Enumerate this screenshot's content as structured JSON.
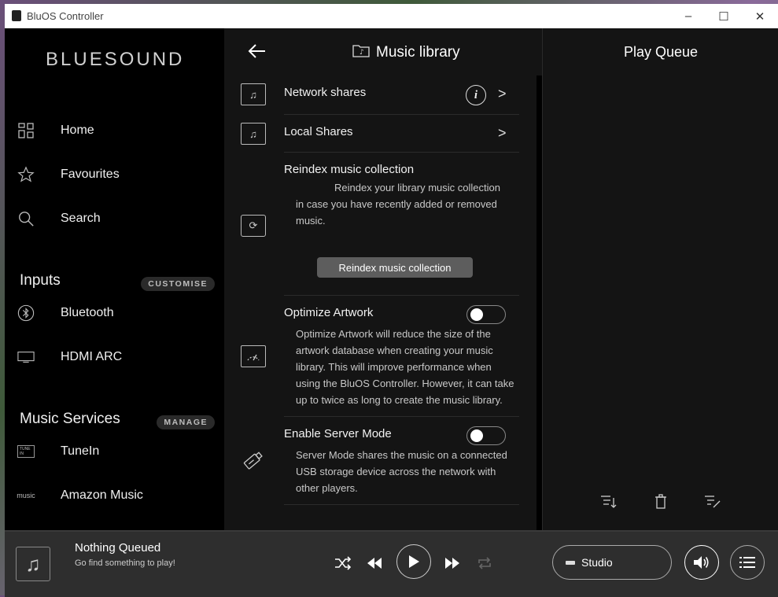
{
  "window": {
    "title": "BluOS Controller",
    "minimize": "–",
    "maximize": "☐",
    "close": "✕"
  },
  "sidebar": {
    "logo": "BLUESOUND",
    "nav": [
      {
        "label": "Home",
        "icon": "grid-icon"
      },
      {
        "label": "Favourites",
        "icon": "star-icon"
      },
      {
        "label": "Search",
        "icon": "search-icon"
      }
    ],
    "inputs_heading": "Inputs",
    "inputs_action": "CUSTOMISE",
    "inputs": [
      {
        "label": "Bluetooth",
        "icon": "bluetooth-icon"
      },
      {
        "label": "HDMI ARC",
        "icon": "tv-icon"
      }
    ],
    "services_heading": "Music Services",
    "services_action": "MANAGE",
    "services": [
      {
        "label": "TuneIn",
        "icon": "tunein-logo-icon"
      },
      {
        "label": "Amazon Music",
        "icon": "amazon-music-logo-icon"
      }
    ]
  },
  "library": {
    "title": "Music library",
    "network_shares": "Network shares",
    "local_shares": "Local Shares",
    "reindex": {
      "title": "Reindex music collection",
      "desc_line1": "Reindex your library music collection",
      "desc_line2": "in case you have recently added or removed",
      "desc_line3": "music.",
      "button": "Reindex music collection"
    },
    "optimize": {
      "title": "Optimize Artwork",
      "enabled": false,
      "desc": [
        "Optimize Artwork will reduce the size of the",
        "artwork database when creating your music",
        "library. This will improve performance when",
        "using the BluOS Controller. However, it can take",
        "up to twice as long to create the music library."
      ]
    },
    "server": {
      "title": "Enable Server Mode",
      "enabled": false,
      "desc": [
        "Server Mode shares the music on a connected",
        "USB storage device across the network with",
        "other players."
      ]
    }
  },
  "queue": {
    "title": "Play Queue"
  },
  "player": {
    "title": "Nothing Queued",
    "subtitle": "Go find something to play!",
    "zone": "Studio"
  },
  "tunein_badge": "TUNE IN",
  "amazon_badge": "music"
}
